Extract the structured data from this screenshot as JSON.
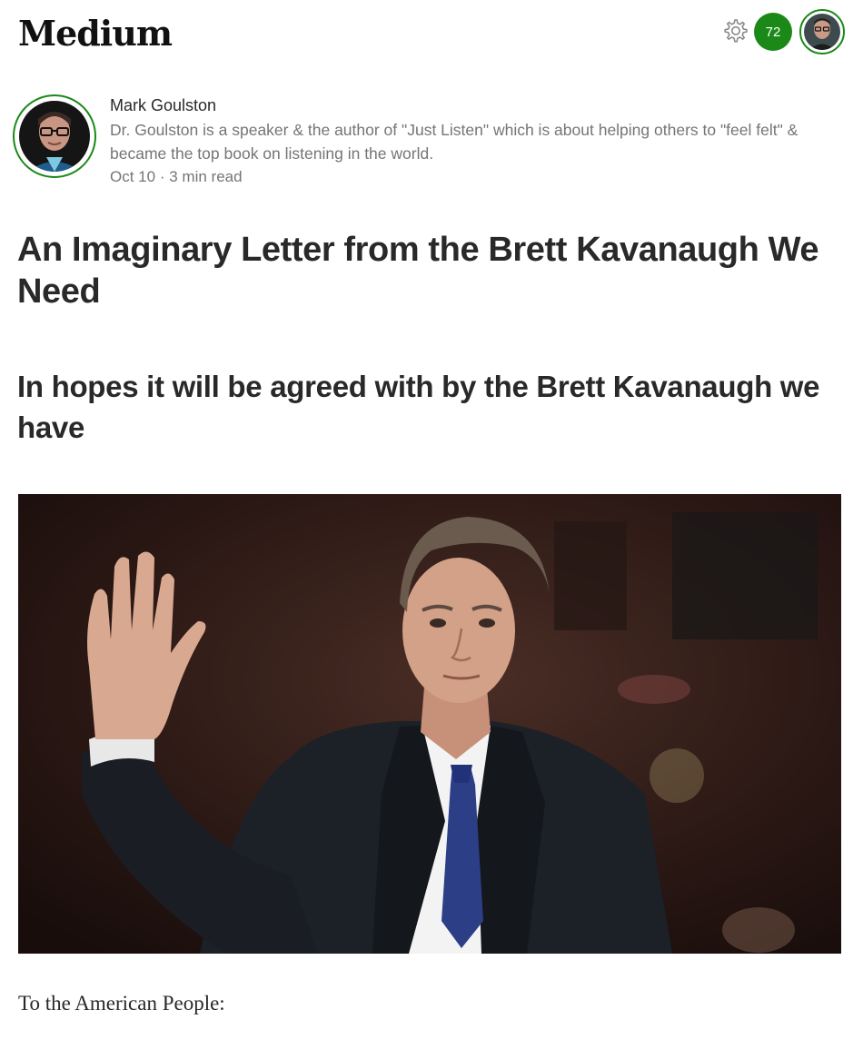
{
  "header": {
    "logo": "Medium",
    "notification_count": "72",
    "icons": {
      "settings": "gear-icon",
      "profile": "avatar"
    }
  },
  "author": {
    "name": "Mark Goulston",
    "bio": "Dr. Goulston is a speaker & the author of \"Just Listen\" which is about helping others to \"feel felt\" & became the top book on listening in the world.",
    "date": "Oct 10",
    "separator": "·",
    "read_time": "3 min read"
  },
  "article": {
    "title": "An Imaginary Letter from the Brett Kavanaugh We Need",
    "subtitle": "In hopes it will be agreed with by the Brett Kavanaugh we have",
    "body_start": "To the American People:"
  },
  "colors": {
    "accent": "#1a8917",
    "text": "#292929",
    "muted": "#757575"
  }
}
